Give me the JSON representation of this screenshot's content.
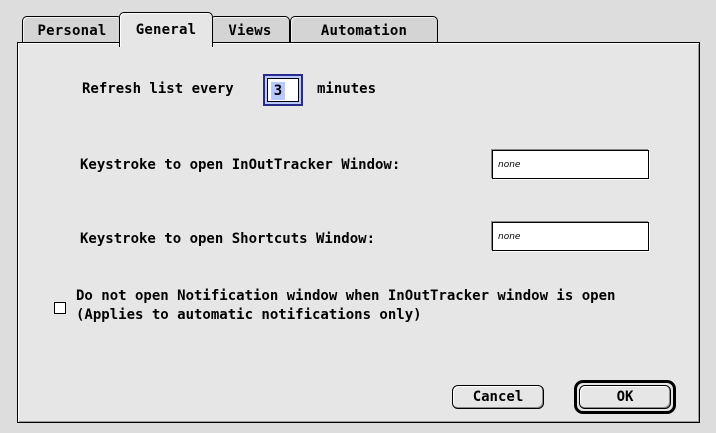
{
  "tabs": [
    "Personal",
    "General",
    "Views",
    "Automation"
  ],
  "active_tab": "General",
  "refresh": {
    "label": "Refresh list every",
    "value": "3",
    "unit": "minutes"
  },
  "keystroke_tracker": {
    "label": "Keystroke to open InOutTracker Window:",
    "value": "none"
  },
  "keystroke_shortcuts": {
    "label": "Keystroke to open Shortcuts Window:",
    "value": "none"
  },
  "notification_option": {
    "line1": "Do not open Notification window when InOutTracker window is open",
    "line2": "(Applies to automatic notifications only)",
    "checked": false
  },
  "buttons": {
    "cancel": "Cancel",
    "ok": "OK"
  }
}
